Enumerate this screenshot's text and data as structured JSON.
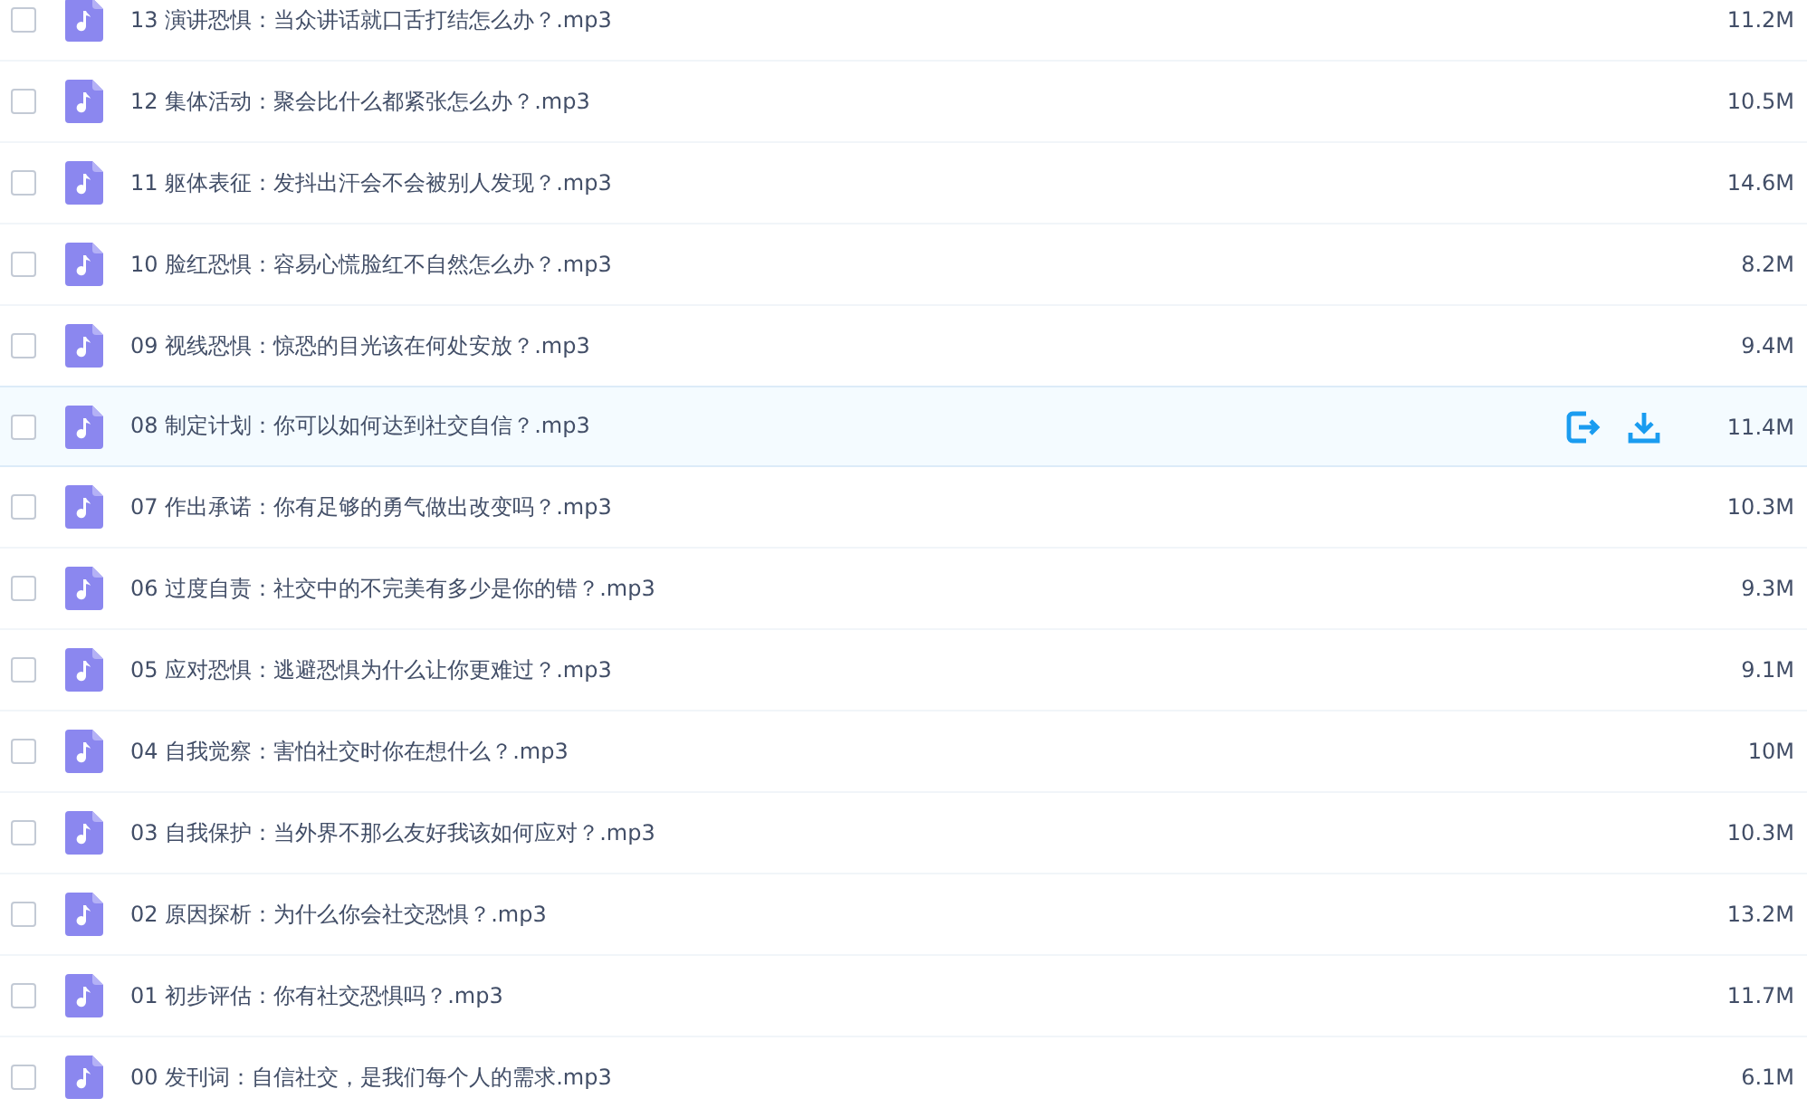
{
  "files": [
    {
      "name": "13 演讲恐惧：当众讲话就口舌打结怎么办？.mp3",
      "size": "11.2M",
      "checked": false,
      "hovered": false
    },
    {
      "name": "12 集体活动：聚会比什么都紧张怎么办？.mp3",
      "size": "10.5M",
      "checked": false,
      "hovered": false
    },
    {
      "name": "11 躯体表征：发抖出汗会不会被别人发现？.mp3",
      "size": "14.6M",
      "checked": false,
      "hovered": false
    },
    {
      "name": "10 脸红恐惧：容易心慌脸红不自然怎么办？.mp3",
      "size": "8.2M",
      "checked": false,
      "hovered": false
    },
    {
      "name": "09 视线恐惧：惊恐的目光该在何处安放？.mp3",
      "size": "9.4M",
      "checked": false,
      "hovered": false
    },
    {
      "name": "08 制定计划：你可以如何达到社交自信？.mp3",
      "size": "11.4M",
      "checked": false,
      "hovered": true
    },
    {
      "name": "07 作出承诺：你有足够的勇气做出改变吗？.mp3",
      "size": "10.3M",
      "checked": false,
      "hovered": false
    },
    {
      "name": "06 过度自责：社交中的不完美有多少是你的错？.mp3",
      "size": "9.3M",
      "checked": false,
      "hovered": false
    },
    {
      "name": "05 应对恐惧：逃避恐惧为什么让你更难过？.mp3",
      "size": "9.1M",
      "checked": false,
      "hovered": false
    },
    {
      "name": "04 自我觉察：害怕社交时你在想什么？.mp3",
      "size": "10M",
      "checked": false,
      "hovered": false
    },
    {
      "name": "03 自我保护：当外界不那么友好我该如何应对？.mp3",
      "size": "10.3M",
      "checked": false,
      "hovered": false
    },
    {
      "name": "02 原因探析：为什么你会社交恐惧？.mp3",
      "size": "13.2M",
      "checked": false,
      "hovered": false
    },
    {
      "name": "01 初步评估：你有社交恐惧吗？.mp3",
      "size": "11.7M",
      "checked": false,
      "hovered": false
    },
    {
      "name": "00 发刊词：自信社交，是我们每个人的需求.mp3",
      "size": "6.1M",
      "checked": false,
      "hovered": false
    }
  ]
}
